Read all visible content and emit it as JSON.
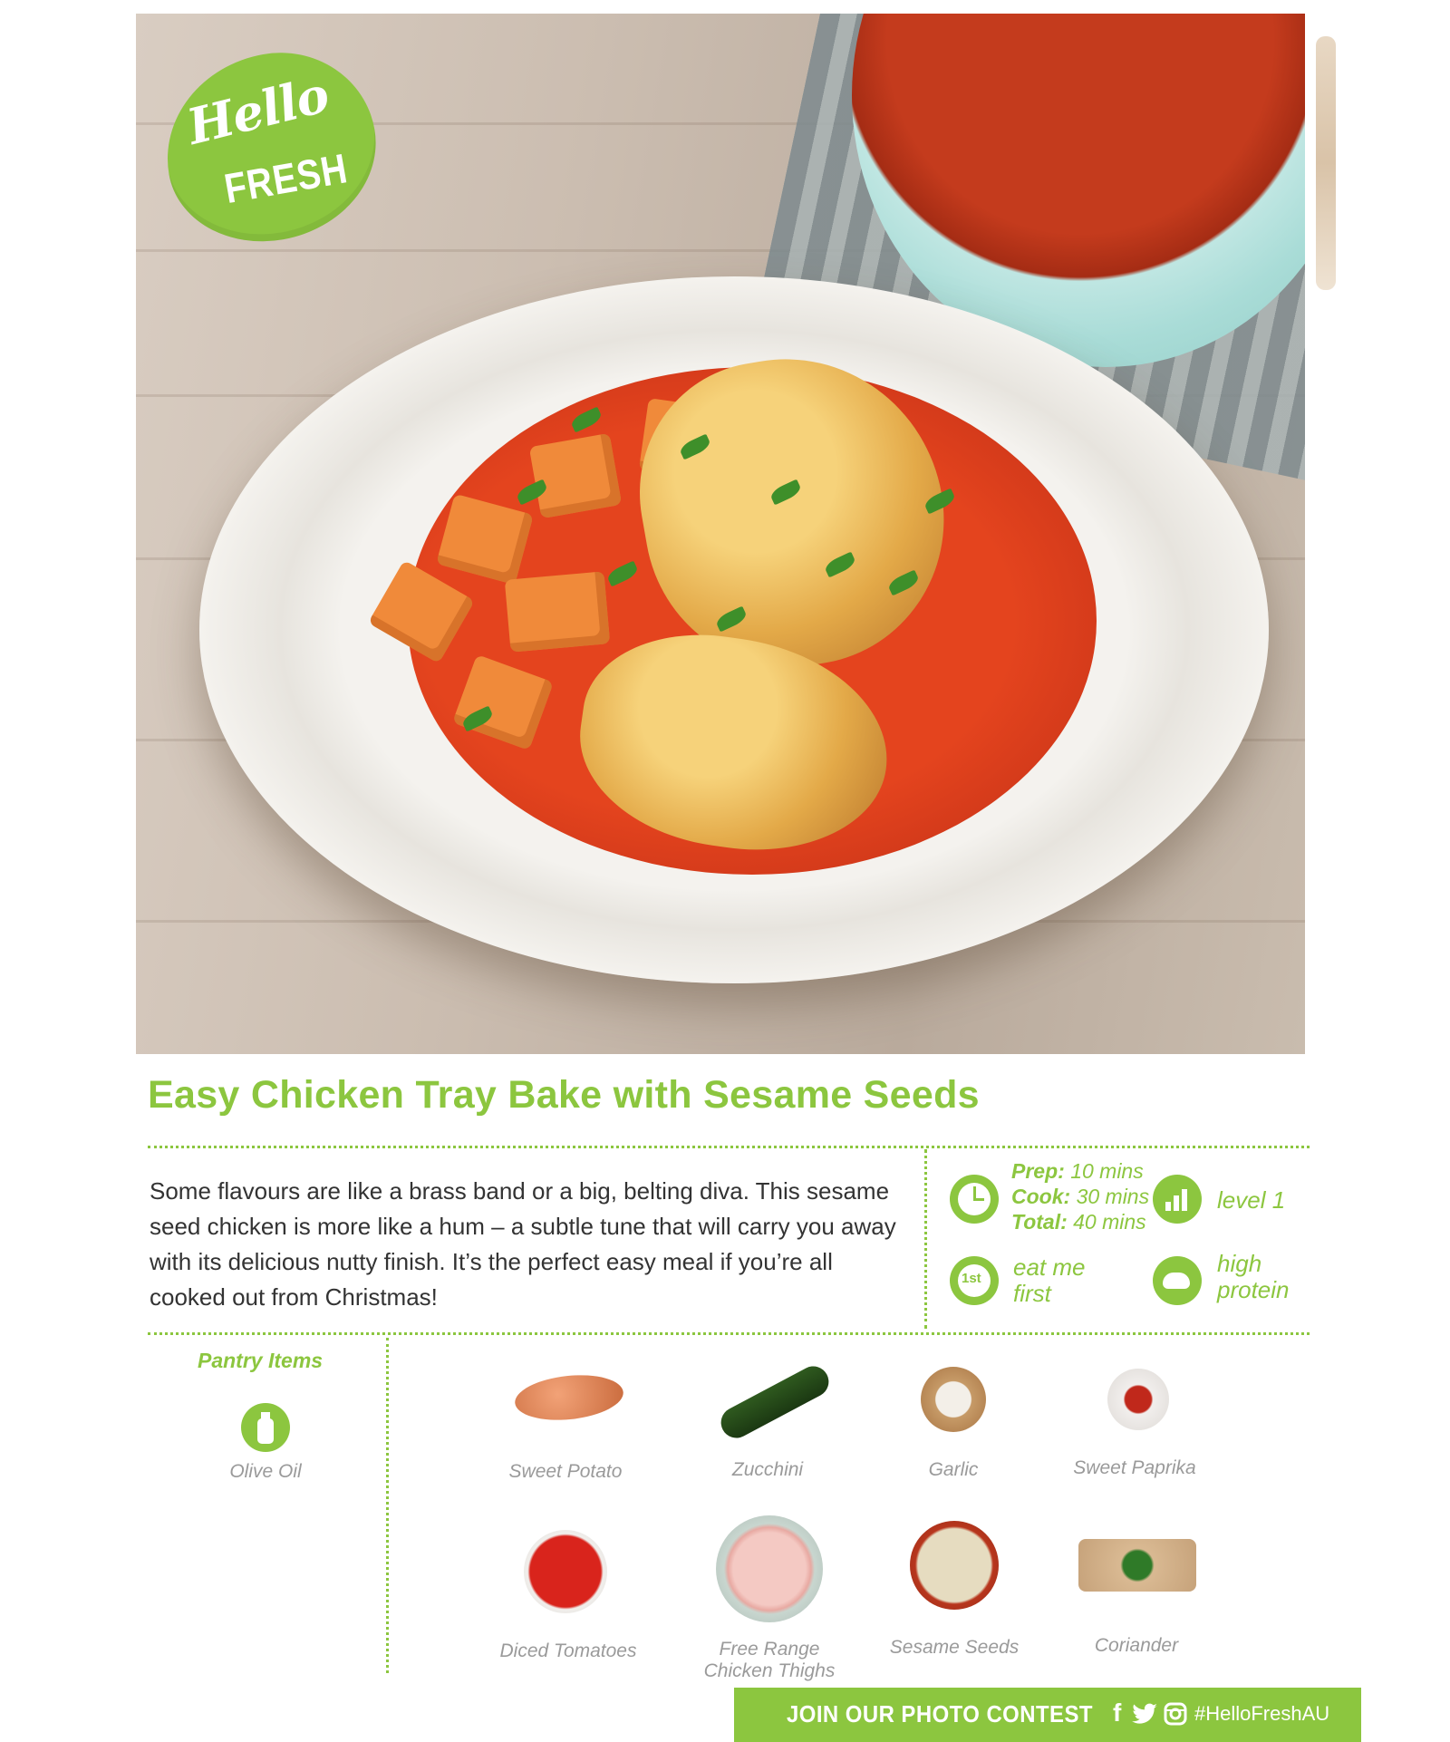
{
  "brand": {
    "logo_top": "Hello",
    "logo_bottom": "FRESH",
    "accent": "#8cc63f"
  },
  "recipe": {
    "title": "Easy Chicken Tray Bake with Sesame Seeds",
    "description": "Some flavours are like a brass band or a big, belting diva. This sesame seed chicken is more like a hum – a subtle tune that will carry you away with its delicious nutty finish. It’s the perfect easy meal if you’re all cooked out from Christmas!"
  },
  "info": {
    "prep_label": "Prep:",
    "prep_value": "10 mins",
    "cook_label": "Cook:",
    "cook_value": "30 mins",
    "total_label": "Total:",
    "total_value": "40 mins",
    "level": "level 1",
    "eat_first_line1": "eat me",
    "eat_first_line2": "first",
    "eat_first_icon": "1st",
    "protein_line1": "high",
    "protein_line2": "protein"
  },
  "pantry": {
    "heading": "Pantry Items",
    "items": [
      "Olive Oil"
    ]
  },
  "ingredients": [
    {
      "name": "Sweet Potato"
    },
    {
      "name": "Zucchini"
    },
    {
      "name": "Garlic"
    },
    {
      "name": "Sweet Paprika"
    },
    {
      "name": "Diced Tomatoes"
    },
    {
      "name_line1": "Free Range",
      "name_line2": "Chicken Thighs"
    },
    {
      "name": "Sesame Seeds"
    },
    {
      "name": "Coriander"
    }
  ],
  "footer": {
    "cta": "JOIN OUR PHOTO CONTEST",
    "social_f": "f",
    "hashtag": "#HelloFreshAU"
  }
}
